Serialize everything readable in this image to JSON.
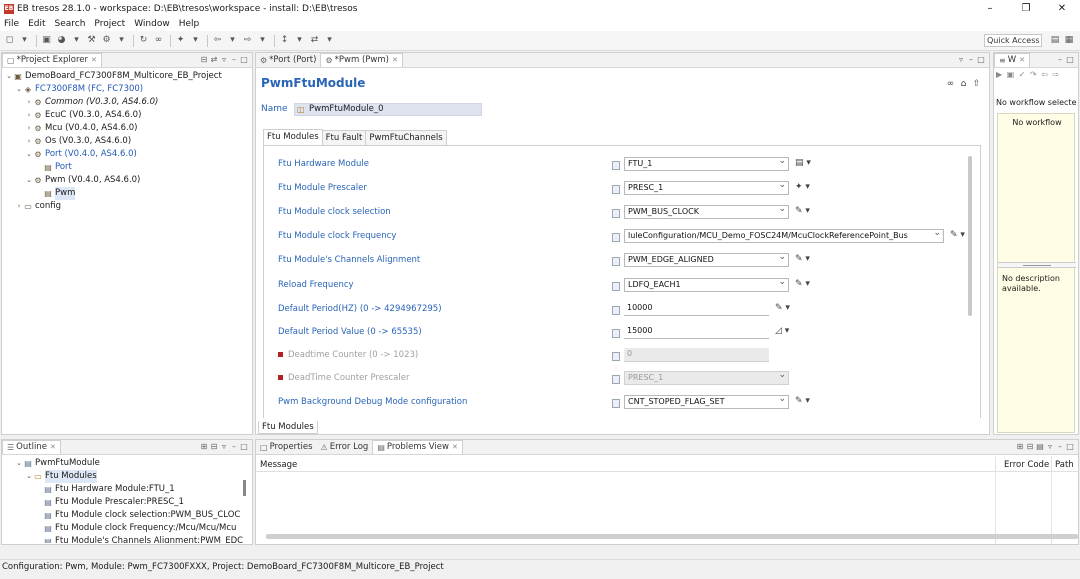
{
  "window": {
    "title": "EB tresos 28.1.0 - workspace: D:\\EB\\tresos\\workspace - install: D:\\EB\\tresos",
    "app_icon": "EB"
  },
  "menu": [
    "File",
    "Edit",
    "Search",
    "Project",
    "Window",
    "Help"
  ],
  "toolbar": {
    "quick_access": "Quick Access"
  },
  "project_explorer": {
    "tab_label": "*Project Explorer",
    "tree": [
      {
        "indent": 0,
        "twisty": "⌄",
        "icon": "project-icon",
        "label": "DemoBoard_FC7300F8M_Multicore_EB_Project",
        "style": ""
      },
      {
        "indent": 1,
        "twisty": "⌄",
        "icon": "ecu-icon",
        "label": "FC7300F8M (FC, FC7300)",
        "style": "blue"
      },
      {
        "indent": 2,
        "twisty": "›",
        "icon": "module-icon",
        "label": "Common (V0.3.0, AS4.6.0)",
        "style": "ital"
      },
      {
        "indent": 2,
        "twisty": "›",
        "icon": "module-icon",
        "label": "EcuC (V0.3.0, AS4.6.0)",
        "style": ""
      },
      {
        "indent": 2,
        "twisty": "›",
        "icon": "module-icon",
        "label": "Mcu (V0.4.0, AS4.6.0)",
        "style": ""
      },
      {
        "indent": 2,
        "twisty": "›",
        "icon": "module-icon",
        "label": "Os (V0.3.0, AS4.6.0)",
        "style": ""
      },
      {
        "indent": 2,
        "twisty": "⌄",
        "icon": "module-icon",
        "label": "Port (V0.4.0, AS4.6.0)",
        "style": "blue"
      },
      {
        "indent": 3,
        "twisty": "",
        "icon": "config-icon",
        "label": "Port",
        "style": "blue"
      },
      {
        "indent": 2,
        "twisty": "⌄",
        "icon": "module-icon",
        "label": "Pwm (V0.4.0, AS4.6.0)",
        "style": ""
      },
      {
        "indent": 3,
        "twisty": "",
        "icon": "config-icon",
        "label": "Pwm",
        "style": "sel"
      },
      {
        "indent": 1,
        "twisty": "›",
        "icon": "folder-icon",
        "label": "config",
        "style": ""
      }
    ]
  },
  "editor": {
    "tabs": [
      {
        "label": "*Port (Port)",
        "active": false
      },
      {
        "label": "*Pwm (Pwm)",
        "active": true
      }
    ],
    "title": "PwmFtuModule",
    "name_label": "Name",
    "name_value": "PwmFtuModule_0",
    "subtabs": [
      {
        "label": "Ftu Modules",
        "active": true
      },
      {
        "label": "Ftu Fault",
        "active": false
      },
      {
        "label": "PwmFtuChannels",
        "active": false
      }
    ],
    "fields": [
      {
        "label": "Ftu Hardware Module",
        "value": "FTU_1",
        "kind": "dd",
        "w": 165,
        "actions": "▤ ▾",
        "disabled": false
      },
      {
        "label": "Ftu Module Prescaler",
        "value": "PRESC_1",
        "kind": "dd",
        "w": 165,
        "actions": "✦ ▾",
        "disabled": false
      },
      {
        "label": "Ftu Module clock selection",
        "value": "PWM_BUS_CLOCK",
        "kind": "dd",
        "w": 165,
        "actions": "✎ ▾",
        "disabled": false
      },
      {
        "label": "Ftu Module clock Frequency",
        "value": "luleConfiguration/MCU_Demo_FOSC24M/McuClockReferencePoint_Bus",
        "kind": "dd",
        "w": 320,
        "actions": "✎ ▾",
        "disabled": false
      },
      {
        "label": "Ftu Module's Channels Alignment",
        "value": "PWM_EDGE_ALIGNED",
        "kind": "dd",
        "w": 165,
        "actions": "✎ ▾",
        "disabled": false
      },
      {
        "label": "Reload Frequency",
        "value": "LDFQ_EACH1",
        "kind": "dd",
        "w": 165,
        "actions": "✎ ▾",
        "disabled": false
      },
      {
        "label": "Default Period(HZ) (0 -> 4294967295)",
        "value": "10000",
        "kind": "txt",
        "w": 145,
        "actions": "✎ ▾",
        "disabled": false
      },
      {
        "label": "Default Period Value (0 -> 65535)",
        "value": "15000",
        "kind": "txt",
        "w": 145,
        "actions": "◿ ▾",
        "disabled": false
      },
      {
        "label": "Deadtime Counter (0 -> 1023)",
        "value": "0",
        "kind": "txt",
        "w": 145,
        "actions": "",
        "disabled": true
      },
      {
        "label": "DeadTime Counter Prescaler",
        "value": "PRESC_1",
        "kind": "dd",
        "w": 165,
        "actions": "",
        "disabled": true
      },
      {
        "label": "Pwm Background Debug Mode configuration",
        "value": "CNT_STOPED_FLAG_SET",
        "kind": "dd",
        "w": 165,
        "actions": "✎ ▾",
        "disabled": false
      }
    ],
    "bottom_tab": "Ftu Modules"
  },
  "workflow": {
    "tab_label": "W",
    "select_text": "No workflow selecte",
    "none_text": "No workflow",
    "desc_text": "No description available."
  },
  "outline": {
    "tab_label": "Outline",
    "tree": [
      {
        "indent": 0,
        "twisty": "⌄",
        "label": "PwmFtuModule",
        "style": ""
      },
      {
        "indent": 1,
        "twisty": "⌄",
        "label": "Ftu Modules",
        "style": "sel"
      },
      {
        "indent": 2,
        "twisty": "",
        "label": "Ftu Hardware Module:FTU_1",
        "style": ""
      },
      {
        "indent": 2,
        "twisty": "",
        "label": "Ftu Module Prescaler:PRESC_1",
        "style": ""
      },
      {
        "indent": 2,
        "twisty": "",
        "label": "Ftu Module clock selection:PWM_BUS_CLOC",
        "style": ""
      },
      {
        "indent": 2,
        "twisty": "",
        "label": "Ftu Module clock Frequency:/Mcu/Mcu/Mcu",
        "style": ""
      },
      {
        "indent": 2,
        "twisty": "",
        "label": "Ftu Module's Channels Alignment:PWM_EDC",
        "style": ""
      }
    ]
  },
  "bottom": {
    "tabs": [
      {
        "label": "Properties",
        "active": false
      },
      {
        "label": "Error Log",
        "active": false
      },
      {
        "label": "Problems View",
        "active": true
      }
    ],
    "col_message": "Message",
    "col_error_code": "Error Code",
    "col_path": "Path"
  },
  "status": "Configuration: Pwm, Module: Pwm_FC7300FXXX, Project: DemoBoard_FC7300F8M_Multicore_EB_Project"
}
